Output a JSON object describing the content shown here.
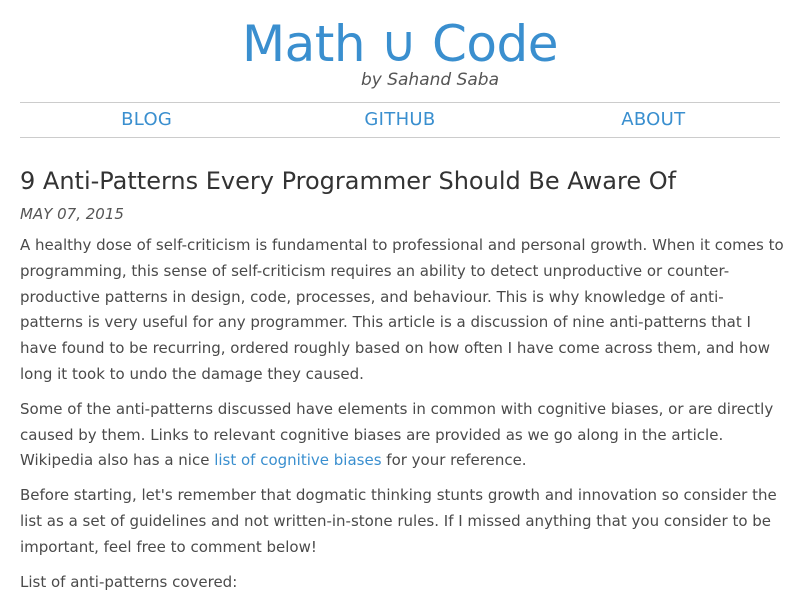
{
  "site": {
    "title": "Math ∪ Code",
    "byline": "by Sahand Saba"
  },
  "nav": {
    "items": [
      "BLOG",
      "GITHUB",
      "ABOUT"
    ]
  },
  "post": {
    "title": "9 Anti-Patterns Every Programmer Should Be Aware Of",
    "date": "MAY 07, 2015",
    "paragraph_1": "A healthy dose of self-criticism is fundamental to professional and personal growth. When it comes to programming, this sense of self-criticism requires an ability to detect unproductive or counter-productive patterns in design, code, processes, and behaviour. This is why knowledge of anti-patterns is very useful for any programmer. This article is a discussion of nine anti-patterns that I have found to be recurring, ordered roughly based on how often I have come across them, and how long it took to undo the damage they caused.",
    "paragraph_2_before": "Some of the anti-patterns discussed have elements in common with cognitive biases, or are directly caused by them. Links to relevant cognitive biases are provided as we go along in the article. Wikipedia also has a nice ",
    "paragraph_2_link": "list of cognitive biases",
    "paragraph_2_after": " for your reference.",
    "paragraph_3": "Before starting, let's remember that dogmatic thinking stunts growth and innovation so consider the list as a set of guidelines and not written-in-stone rules. If I missed anything that you consider to be important, feel free to comment below!",
    "paragraph_4": "List of anti-patterns covered:"
  },
  "colors": {
    "accent": "#3a8fcf",
    "text": "#4a4a4a",
    "rule": "#cccccc"
  }
}
